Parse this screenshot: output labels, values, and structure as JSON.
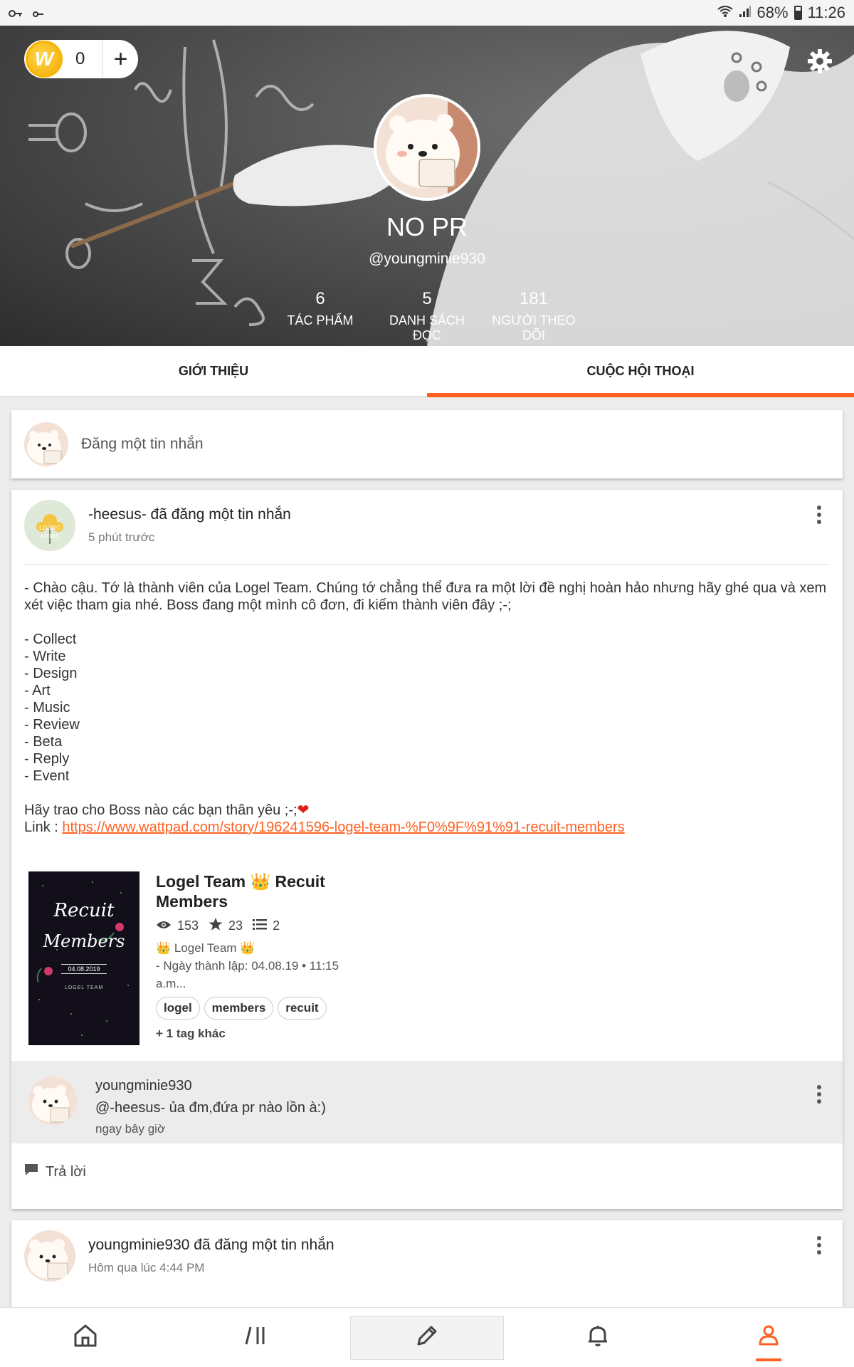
{
  "status_bar": {
    "battery": "68%",
    "time": "11:26"
  },
  "header": {
    "coin_count": "0",
    "coin_letter": "W",
    "name": "NO PR",
    "handle": "@youngminie930",
    "stats": [
      {
        "value": "6",
        "label": "TÁC PHẨM"
      },
      {
        "value": "5",
        "label": "DANH SÁCH ĐỌC"
      },
      {
        "value": "181",
        "label": "NGƯỜI THEO DÕI"
      }
    ]
  },
  "tabs": [
    {
      "label": "GIỚI THIỆU",
      "active": false
    },
    {
      "label": "CUỘC HỘI THOẠI",
      "active": true
    }
  ],
  "compose": {
    "placeholder": "Đăng một tin nhắn"
  },
  "post": {
    "author": "-heesus-",
    "action": " đã đăng một tin nhắn",
    "time": "5 phút trước",
    "paragraph1": "- Chào cậu. Tớ là thành viên của Logel Team. Chúng tớ chẳng thể đưa ra một lời đề nghị hoàn hảo nhưng hãy ghé qua và xem xét việc tham gia nhé. Boss đang một mình cô đơn, đi kiếm thành viên đây ;-;",
    "list": [
      "- Collect",
      "- Write",
      "- Design",
      "- Art",
      "- Music",
      "- Review",
      "- Beta",
      "- Reply",
      "- Event"
    ],
    "closing": "Hãy trao cho Boss nào các bạn thân yêu ;-;",
    "link_label": "Link : ",
    "link_url": "https://www.wattpad.com/story/196241596-logel-team-%F0%9F%91%91-recuit-members",
    "story": {
      "cover_line1": "Recuit",
      "cover_line2": "Members",
      "cover_date": "04.08.2019",
      "cover_team": "LOGEL TEAM",
      "title": "Logel Team 👑 Recuit Members",
      "views": "153",
      "votes": "23",
      "parts": "2",
      "author": "👑 Logel Team 👑",
      "description": "- Ngày thành lập: 04.08.19 • 11:15 a.m...",
      "tags": [
        "logel",
        "members",
        "recuit"
      ],
      "more_tags": "+ 1 tag khác"
    },
    "reply": {
      "author": "youngminie930",
      "text": "@-heesus-   ủa đm,đứa pr nào lồn à:)",
      "time": "ngay bây giờ"
    },
    "reply_action": "Trả lời"
  },
  "post2": {
    "author": "youngminie930",
    "action": " đã đăng một tin nhắn",
    "time": "Hôm qua lúc 4:44 PM"
  },
  "bottom_nav": [
    {
      "icon": "home-icon"
    },
    {
      "icon": "library-icon"
    },
    {
      "icon": "pencil-icon"
    },
    {
      "icon": "bell-icon"
    },
    {
      "icon": "profile-icon",
      "active": true
    }
  ],
  "colors": {
    "accent": "#ff6122",
    "link": "#ff6122"
  }
}
